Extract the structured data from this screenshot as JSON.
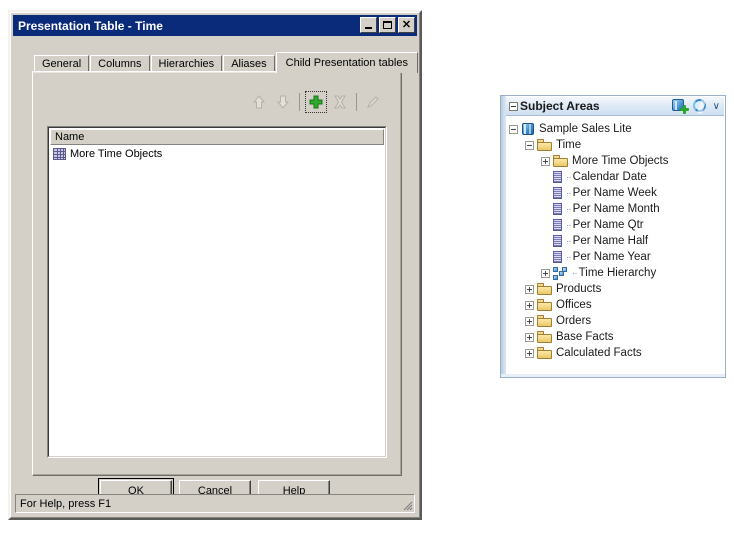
{
  "dialog": {
    "title": "Presentation Table - Time",
    "title_buttons": [
      {
        "name": "minimize",
        "label": "_"
      },
      {
        "name": "maximize",
        "label": "□"
      },
      {
        "name": "close",
        "label": "✕"
      }
    ],
    "tabs": [
      {
        "label": "General",
        "active": false
      },
      {
        "label": "Columns",
        "active": false
      },
      {
        "label": "Hierarchies",
        "active": false
      },
      {
        "label": "Aliases",
        "active": false
      },
      {
        "label": "Child Presentation tables",
        "active": true
      }
    ],
    "toolbar": [
      {
        "name": "move-up-icon",
        "enabled": false
      },
      {
        "name": "move-down-icon",
        "enabled": false
      },
      {
        "name": "add-icon",
        "enabled": true,
        "focused": true
      },
      {
        "name": "delete-icon",
        "enabled": false
      },
      {
        "name": "edit-icon",
        "enabled": false
      }
    ],
    "listview": {
      "column_header": "Name",
      "rows": [
        {
          "icon": "presentation-table-icon",
          "label": "More Time Objects"
        }
      ]
    },
    "buttons": [
      {
        "label": "OK",
        "default": true
      },
      {
        "label": "Cancel",
        "default": false
      },
      {
        "label": "Help",
        "default": false
      }
    ],
    "statusbar": {
      "text": "For Help, press F1"
    }
  },
  "subject_areas": {
    "title": "Subject Areas",
    "header_icons": [
      {
        "name": "add-subject-area-icon"
      },
      {
        "name": "refresh-icon"
      },
      {
        "name": "chevron-down-icon",
        "glyph": "∨"
      }
    ],
    "tree": [
      {
        "label": "Sample Sales Lite",
        "icon": "subject-area-icon",
        "indent": 0,
        "state": "expanded"
      },
      {
        "label": "Time",
        "icon": "folder-icon",
        "indent": 1,
        "state": "expanded"
      },
      {
        "label": "More Time Objects",
        "icon": "folder-icon",
        "indent": 2,
        "state": "collapsed"
      },
      {
        "label": "Calendar Date",
        "icon": "column-icon",
        "indent": 2,
        "state": "leaf"
      },
      {
        "label": "Per Name Week",
        "icon": "column-icon",
        "indent": 2,
        "state": "leaf"
      },
      {
        "label": "Per Name Month",
        "icon": "column-icon",
        "indent": 2,
        "state": "leaf"
      },
      {
        "label": "Per Name Qtr",
        "icon": "column-icon",
        "indent": 2,
        "state": "leaf"
      },
      {
        "label": "Per Name Half",
        "icon": "column-icon",
        "indent": 2,
        "state": "leaf"
      },
      {
        "label": "Per Name Year",
        "icon": "column-icon",
        "indent": 2,
        "state": "leaf"
      },
      {
        "label": "Time Hierarchy",
        "icon": "hierarchy-icon",
        "indent": 2,
        "state": "collapsed"
      },
      {
        "label": "Products",
        "icon": "folder-icon",
        "indent": 1,
        "state": "collapsed"
      },
      {
        "label": "Offices",
        "icon": "folder-icon",
        "indent": 1,
        "state": "collapsed"
      },
      {
        "label": "Orders",
        "icon": "folder-icon",
        "indent": 1,
        "state": "collapsed"
      },
      {
        "label": "Base Facts",
        "icon": "folder-icon",
        "indent": 1,
        "state": "collapsed"
      },
      {
        "label": "Calculated Facts",
        "icon": "folder-icon",
        "indent": 1,
        "state": "collapsed"
      }
    ]
  },
  "colors": {
    "titlebar": "#0a2a7a",
    "dialog_face": "#d4d0c8",
    "panel_border": "#9bb0c8",
    "accent_green": "#2aa62a",
    "accent_blue": "#3b87c9"
  }
}
